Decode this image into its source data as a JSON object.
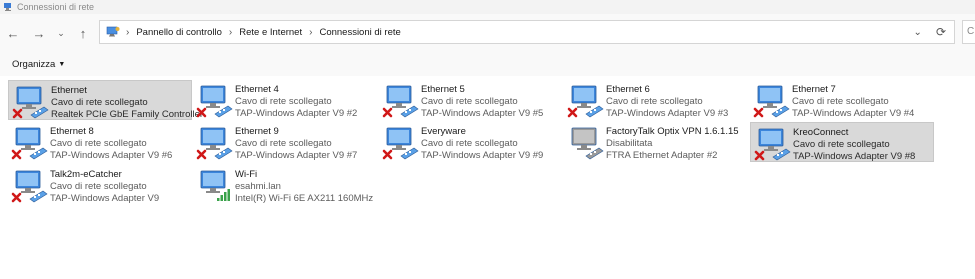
{
  "window": {
    "title": "Connessioni di rete"
  },
  "address": {
    "breadcrumb": [
      "Pannello di controllo",
      "Rete e Internet",
      "Connessioni di rete"
    ],
    "search_placeholder": "C"
  },
  "toolbar": {
    "organize_label": "Organizza"
  },
  "connections": [
    {
      "name": "Ethernet",
      "status": "Cavo di rete scollegato",
      "adapter": "Realtek PCIe GbE Family Controller",
      "kind": "ethernet-disconnected",
      "selected": true
    },
    {
      "name": "Ethernet 4",
      "status": "Cavo di rete scollegato",
      "adapter": "TAP-Windows Adapter V9 #2",
      "kind": "ethernet-disconnected",
      "selected": false
    },
    {
      "name": "Ethernet 5",
      "status": "Cavo di rete scollegato",
      "adapter": "TAP-Windows Adapter V9 #5",
      "kind": "ethernet-disconnected",
      "selected": false
    },
    {
      "name": "Ethernet 6",
      "status": "Cavo di rete scollegato",
      "adapter": "TAP-Windows Adapter V9 #3",
      "kind": "ethernet-disconnected",
      "selected": false
    },
    {
      "name": "Ethernet 7",
      "status": "Cavo di rete scollegato",
      "adapter": "TAP-Windows Adapter V9 #4",
      "kind": "ethernet-disconnected",
      "selected": false
    },
    {
      "name": "Ethernet 8",
      "status": "Cavo di rete scollegato",
      "adapter": "TAP-Windows Adapter V9 #6",
      "kind": "ethernet-disconnected",
      "selected": false
    },
    {
      "name": "Ethernet 9",
      "status": "Cavo di rete scollegato",
      "adapter": "TAP-Windows Adapter V9 #7",
      "kind": "ethernet-disconnected",
      "selected": false
    },
    {
      "name": "Everyware",
      "status": "Cavo di rete scollegato",
      "adapter": "TAP-Windows Adapter V9 #9",
      "kind": "ethernet-disconnected",
      "selected": false
    },
    {
      "name": "FactoryTalk Optix VPN 1.6.1.15",
      "status": "Disabilitata",
      "adapter": "FTRA Ethernet Adapter #2",
      "kind": "ethernet-disabled",
      "selected": false
    },
    {
      "name": "KreoConnect",
      "status": "Cavo di rete scollegato",
      "adapter": "TAP-Windows Adapter V9 #8",
      "kind": "ethernet-disconnected",
      "selected": true
    },
    {
      "name": "Talk2m-eCatcher",
      "status": "Cavo di rete scollegato",
      "adapter": "TAP-Windows Adapter V9",
      "kind": "ethernet-disconnected",
      "selected": false
    },
    {
      "name": "Wi-Fi",
      "status": "esahmi.lan",
      "adapter": "Intel(R) Wi-Fi 6E AX211 160MHz",
      "kind": "wifi-connected",
      "selected": false
    }
  ]
}
